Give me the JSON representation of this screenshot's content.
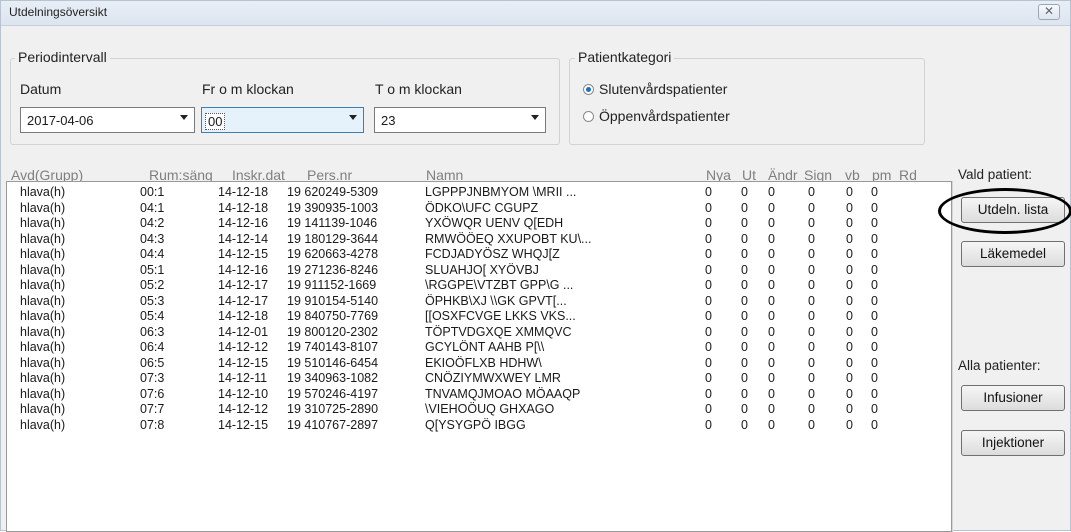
{
  "window": {
    "title": "Utdelningsöversikt",
    "close_symbol": "✕"
  },
  "period": {
    "legend": "Periodintervall",
    "date_label": "Datum",
    "date_value": "2017-04-06",
    "from_label": "Fr o m klockan",
    "from_value": "00",
    "to_label": "T o m klockan",
    "to_value": "23"
  },
  "patient_category": {
    "legend": "Patientkategori",
    "options": [
      {
        "label": "Slutenvårdspatienter",
        "selected": true
      },
      {
        "label": "Öppenvårdspatienter",
        "selected": false
      }
    ]
  },
  "table": {
    "columns": [
      "Avd(Grupp)",
      "Rum:säng",
      "Inskr.dat",
      "Pers.nr",
      "Namn",
      "Nya",
      "Ut",
      "Ändr",
      "Sign",
      "vb",
      "pm",
      "Rd"
    ],
    "rows": [
      [
        "hlava(h)",
        "00:1",
        "14-12-18",
        "19 620249-5309",
        "LGPPPJNBMYOM \\MRII ...",
        "0",
        "0",
        "0",
        "0",
        "0",
        "0"
      ],
      [
        "hlava(h)",
        "04:1",
        "14-12-18",
        "19 390935-1003",
        "ÖDKO\\UFC CGUPZ",
        "0",
        "0",
        "0",
        "0",
        "0",
        "0"
      ],
      [
        "hlava(h)",
        "04:2",
        "14-12-16",
        "19 141139-1046",
        "YXÖWQR UENV Q[EDH",
        "0",
        "0",
        "0",
        "0",
        "0",
        "0"
      ],
      [
        "hlava(h)",
        "04:3",
        "14-12-14",
        "19 180129-3644",
        "RMWÖÖEQ XXUPOBT KU\\...",
        "0",
        "0",
        "0",
        "0",
        "0",
        "0"
      ],
      [
        "hlava(h)",
        "04:4",
        "14-12-15",
        "19 620663-4278",
        "FCDJADYÖSZ WHQJ[Z",
        "0",
        "0",
        "0",
        "0",
        "0",
        "0"
      ],
      [
        "hlava(h)",
        "05:1",
        "14-12-16",
        "19 271236-8246",
        "SLUAHJO[ XYÖVBJ",
        "0",
        "0",
        "0",
        "0",
        "0",
        "0"
      ],
      [
        "hlava(h)",
        "05:2",
        "14-12-17",
        "19 911152-1669",
        "\\RGGPE\\VTZBT GPP\\G ...",
        "0",
        "0",
        "0",
        "0",
        "0",
        "0"
      ],
      [
        "hlava(h)",
        "05:3",
        "14-12-17",
        "19 910154-5140",
        "ÖPHKB\\XJ \\\\GK GPVT[...",
        "0",
        "0",
        "0",
        "0",
        "0",
        "0"
      ],
      [
        "hlava(h)",
        "05:4",
        "14-12-18",
        "19 840750-7769",
        "[[OSXFCVGE LKKS VKS...",
        "0",
        "0",
        "0",
        "0",
        "0",
        "0"
      ],
      [
        "hlava(h)",
        "06:3",
        "14-12-01",
        "19 800120-2302",
        "TÖPTVDGXQE XMMQVC",
        "0",
        "0",
        "0",
        "0",
        "0",
        "0"
      ],
      [
        "hlava(h)",
        "06:4",
        "14-12-12",
        "19 740143-8107",
        "GCYLÖNT AAHB P[\\\\",
        "0",
        "0",
        "0",
        "0",
        "0",
        "0"
      ],
      [
        "hlava(h)",
        "06:5",
        "14-12-15",
        "19 510146-6454",
        "EKIOÖFLXB HDHW\\",
        "0",
        "0",
        "0",
        "0",
        "0",
        "0"
      ],
      [
        "hlava(h)",
        "07:3",
        "14-12-11",
        "19 340963-1082",
        "CNÖZIYMWXWEY LMR",
        "0",
        "0",
        "0",
        "0",
        "0",
        "0"
      ],
      [
        "hlava(h)",
        "07:6",
        "14-12-10",
        "19 570246-4197",
        "TNVAMQJMOAO MÖAAQP",
        "0",
        "0",
        "0",
        "0",
        "0",
        "0"
      ],
      [
        "hlava(h)",
        "07:7",
        "14-12-12",
        "19 310725-2890",
        "\\VIEHOÖUQ GHXAGO",
        "0",
        "0",
        "0",
        "0",
        "0",
        "0"
      ],
      [
        "hlava(h)",
        "07:8",
        "14-12-15",
        "19 410767-2897",
        "Q[YSYGPÖ IBGG",
        "0",
        "0",
        "0",
        "0",
        "0",
        "0"
      ]
    ]
  },
  "side": {
    "selected_label": "Vald patient:",
    "btn_list": "Utdeln. lista",
    "btn_drugs": "Läkemedel",
    "all_label": "Alla patienter:",
    "btn_infusions": "Infusioner",
    "btn_injections": "Injektioner"
  }
}
